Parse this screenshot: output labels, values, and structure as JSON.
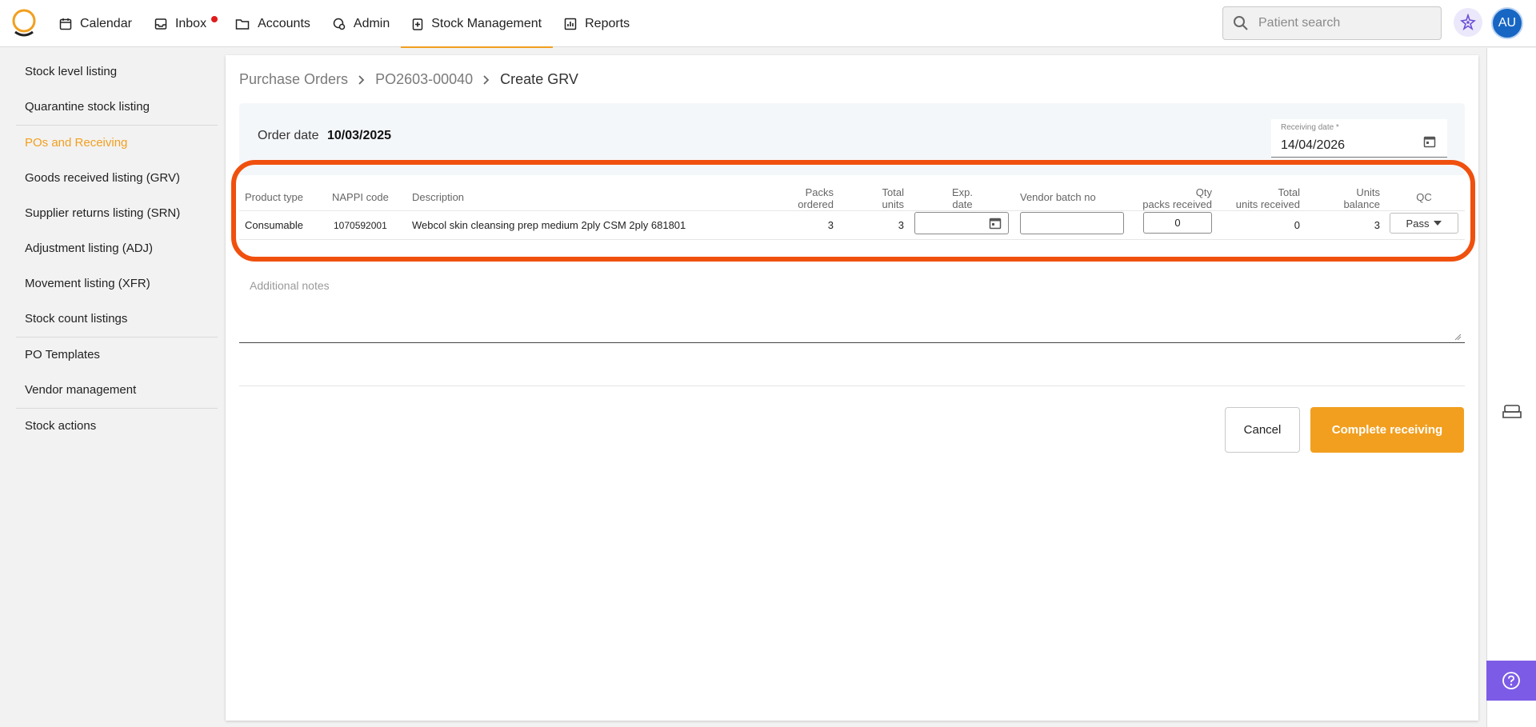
{
  "nav": {
    "items": [
      {
        "label": "Calendar",
        "icon": "calendar-icon"
      },
      {
        "label": "Inbox",
        "icon": "inbox-icon"
      },
      {
        "label": "Accounts",
        "icon": "folder-icon"
      },
      {
        "label": "Admin",
        "icon": "admin-icon"
      },
      {
        "label": "Stock Management",
        "icon": "medical-box-icon"
      },
      {
        "label": "Reports",
        "icon": "bar-chart-icon"
      }
    ],
    "active": "Stock Management",
    "search_placeholder": "Patient search",
    "avatar_initials": "AU",
    "accent_color": "#f29f1f"
  },
  "sidebar": {
    "items": [
      {
        "label": "Stock level listing"
      },
      {
        "label": "Quarantine stock listing"
      },
      {
        "label": "POs and Receiving"
      },
      {
        "label": "Goods received listing (GRV)"
      },
      {
        "label": "Supplier returns listing (SRN)"
      },
      {
        "label": "Adjustment listing (ADJ)"
      },
      {
        "label": "Movement listing (XFR)"
      },
      {
        "label": "Stock count listings"
      },
      {
        "label": "PO Templates"
      },
      {
        "label": "Vendor management"
      },
      {
        "label": "Stock actions"
      }
    ],
    "active": "POs and Receiving"
  },
  "breadcrumb": {
    "items": [
      "Purchase Orders",
      "PO2603-00040",
      "Create GRV"
    ]
  },
  "order": {
    "date_label": "Order date",
    "date_value": "10/03/2025",
    "receiving_label": "Receiving date *",
    "receiving_value": "14/04/2026"
  },
  "table": {
    "headers": {
      "product_type": "Product type",
      "nappi": "NAPPI code",
      "description": "Description",
      "packs_ordered_1": "Packs",
      "packs_ordered_2": "ordered",
      "total_units_1": "Total",
      "total_units_2": "units",
      "exp_1": "Exp.",
      "exp_2": "date",
      "vendor_batch": "Vendor batch no",
      "qty_1": "Qty",
      "qty_2": "packs received",
      "tur_1": "Total",
      "tur_2": "units received",
      "ub_1": "Units",
      "ub_2": "balance",
      "qc": "QC"
    },
    "row": {
      "product_type": "Consumable",
      "nappi": "1070592001",
      "description": "Webcol skin cleansing prep medium 2ply CSM 2ply 681801",
      "packs_ordered": "3",
      "total_units": "3",
      "exp_date": "",
      "vendor_batch": "",
      "qty_received": "0",
      "total_units_received": "0",
      "units_balance": "3",
      "qc": "Pass"
    }
  },
  "notes": {
    "placeholder": "Additional notes"
  },
  "actions": {
    "cancel_label": "Cancel",
    "complete_label": "Complete receiving"
  },
  "highlight_color": "#f0500e"
}
